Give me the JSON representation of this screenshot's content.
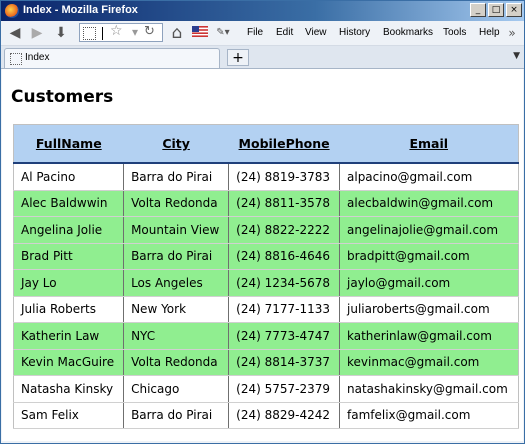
{
  "window": {
    "title": "Index - Mozilla Firefox",
    "minimize": "_",
    "maximize": "□",
    "close": "×"
  },
  "toolbar": {
    "back_icon": "◀",
    "forward_icon": "▶",
    "download_icon": "⬇",
    "home_icon": "⌂"
  },
  "menu": [
    "File",
    "Edit",
    "View",
    "History",
    "Bookmarks",
    "Tools",
    "Help"
  ],
  "tab": {
    "label": "Index",
    "new_tab": "+"
  },
  "page": {
    "heading": "Customers"
  },
  "table": {
    "headers": [
      "FullName",
      "City",
      "MobilePhone",
      "Email"
    ],
    "rows": [
      {
        "cells": [
          "Al Pacino",
          "Barra do Pirai",
          "(24) 8819-3783",
          "alpacino@gmail.com"
        ],
        "highlight": false
      },
      {
        "cells": [
          "Alec Baldwwin",
          "Volta Redonda",
          "(24) 8811-3578",
          "alecbaldwin@gmail.com"
        ],
        "highlight": true
      },
      {
        "cells": [
          "Angelina Jolie",
          "Mountain View",
          "(24) 8822-2222",
          "angelinajolie@gmail.com"
        ],
        "highlight": true
      },
      {
        "cells": [
          "Brad Pitt",
          "Barra do Pirai",
          "(24) 8816-4646",
          "bradpitt@gmail.com"
        ],
        "highlight": true
      },
      {
        "cells": [
          "Jay Lo",
          "Los Angeles",
          "(24) 1234-5678",
          "jaylo@gmail.com"
        ],
        "highlight": true
      },
      {
        "cells": [
          "Julia Roberts",
          "New York",
          "(24) 7177-1133",
          "juliaroberts@gmail.com"
        ],
        "highlight": false
      },
      {
        "cells": [
          "Katherin Law",
          "NYC",
          "(24) 7773-4747",
          "katherinlaw@gmail.com"
        ],
        "highlight": true
      },
      {
        "cells": [
          "Kevin MacGuire",
          "Volta Redonda",
          "(24) 8814-3737",
          "kevinmac@gmail.com"
        ],
        "highlight": true
      },
      {
        "cells": [
          "Natasha Kinsky",
          "Chicago",
          "(24) 5757-2379",
          "natashakinsky@gmail.com"
        ],
        "highlight": false
      },
      {
        "cells": [
          "Sam Felix",
          "Barra do Pirai",
          "(24) 8829-4242",
          "famfelix@gmail.com"
        ],
        "highlight": false
      }
    ]
  },
  "colors": {
    "highlight_row": "#90ee90",
    "header_bg": "#b3d1f2"
  }
}
